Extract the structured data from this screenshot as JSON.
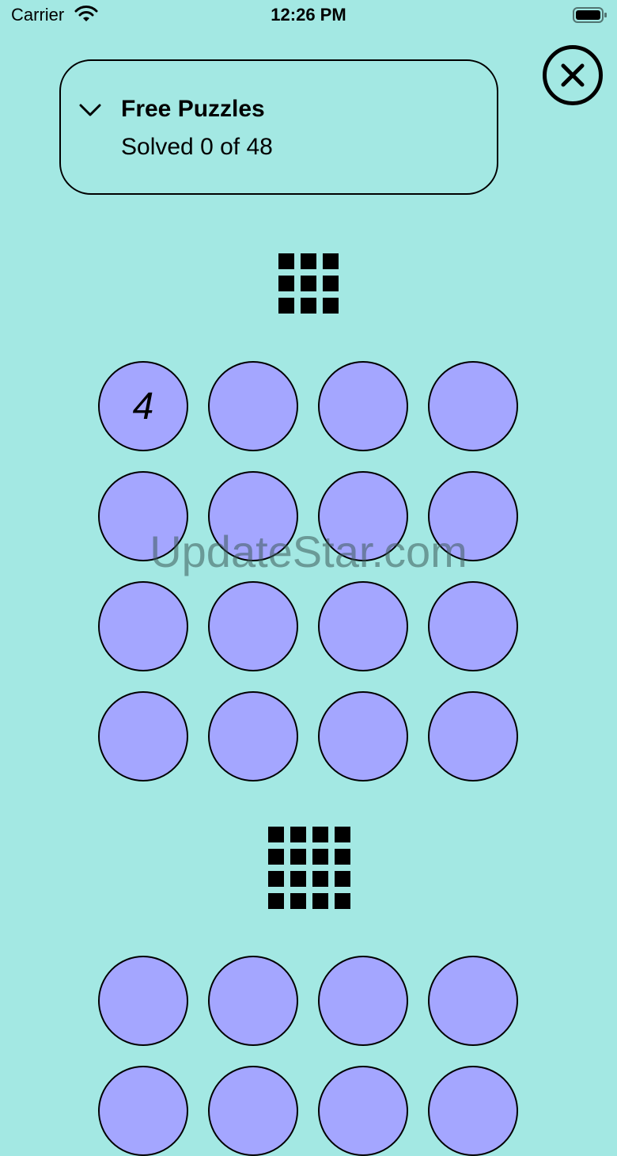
{
  "status_bar": {
    "carrier": "Carrier",
    "time": "12:26 PM"
  },
  "header": {
    "title": "Free Puzzles",
    "progress_text": "Solved 0 of 48",
    "expand_icon": "chevron-down-icon",
    "close_icon": "close-circle-icon"
  },
  "sections": [
    {
      "grid_icon": "3x3-grid-icon",
      "puzzles": [
        {
          "number": "4"
        },
        {
          "number": ""
        },
        {
          "number": ""
        },
        {
          "number": ""
        },
        {
          "number": ""
        },
        {
          "number": ""
        },
        {
          "number": ""
        },
        {
          "number": ""
        },
        {
          "number": ""
        },
        {
          "number": ""
        },
        {
          "number": ""
        },
        {
          "number": ""
        },
        {
          "number": ""
        },
        {
          "number": ""
        },
        {
          "number": ""
        },
        {
          "number": ""
        }
      ]
    },
    {
      "grid_icon": "4x4-grid-icon",
      "puzzles": [
        {
          "number": ""
        },
        {
          "number": ""
        },
        {
          "number": ""
        },
        {
          "number": ""
        },
        {
          "number": ""
        },
        {
          "number": ""
        },
        {
          "number": ""
        },
        {
          "number": ""
        }
      ]
    }
  ],
  "watermark": "UpdateStar.com",
  "colors": {
    "background": "#a3e8e3",
    "puzzle_fill": "#a4a6ff",
    "stroke": "#000000"
  }
}
